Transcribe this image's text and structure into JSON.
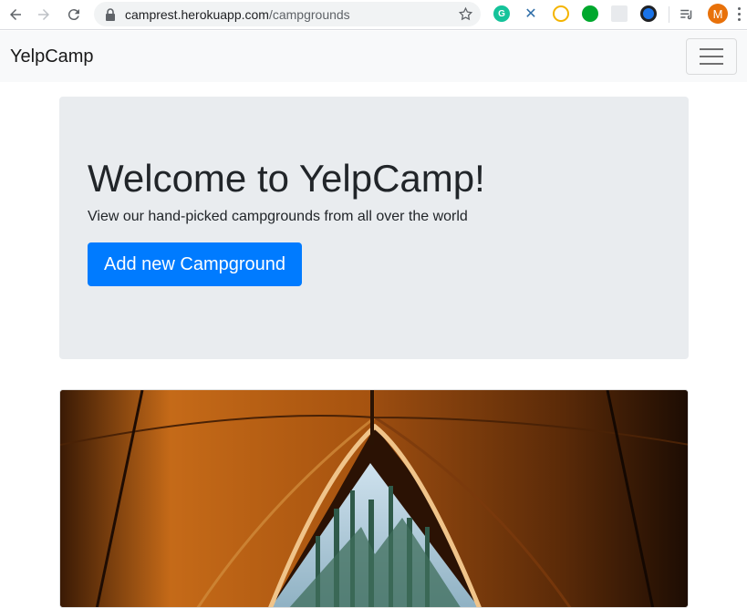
{
  "browser": {
    "url_host": "camprest.herokuapp.com",
    "url_path": "/campgrounds",
    "profile_initial": "M",
    "extensions": [
      {
        "name": "grammarly-icon",
        "color": "#15c39a"
      },
      {
        "name": "x-tool-icon",
        "color": "#2f6ea8"
      },
      {
        "name": "chrome-ext-icon",
        "color": "#f4b400"
      },
      {
        "name": "evernote-icon",
        "color": "#00a82d"
      },
      {
        "name": "grid-ext-icon",
        "color": "#9aa0a6"
      },
      {
        "name": "circle-ext-icon",
        "color": "#1a73e8"
      }
    ]
  },
  "navbar": {
    "brand": "YelpCamp"
  },
  "jumbotron": {
    "title": "Welcome to YelpCamp!",
    "lead": "View our hand-picked campgrounds from all over the world",
    "button_label": "Add new Campground"
  },
  "colors": {
    "primary": "#007bff",
    "jumbotron_bg": "#e9ecef",
    "navbar_bg": "#f8f9fa"
  }
}
